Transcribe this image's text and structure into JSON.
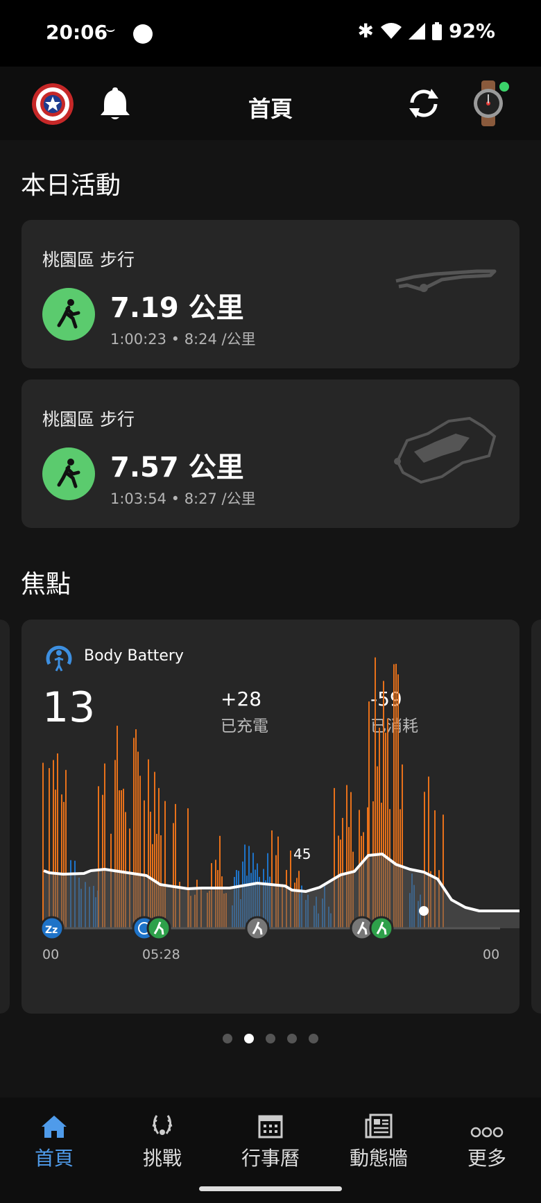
{
  "status_bar": {
    "time": "20:06",
    "battery": "92%"
  },
  "app_bar": {
    "title": "首頁"
  },
  "today": {
    "heading": "本日活動",
    "activities": [
      {
        "title": "桃園區 步行",
        "distance": "7.19 公里",
        "sub": "1:00:23 • 8:24 /公里",
        "icon": "walking-icon"
      },
      {
        "title": "桃園區 步行",
        "distance": "7.57 公里",
        "sub": "1:03:54 • 8:27 /公里",
        "icon": "walking-icon"
      }
    ]
  },
  "focus": {
    "heading": "焦點",
    "body_battery": {
      "title": "Body Battery",
      "value": "13",
      "charged_value": "+28",
      "charged_label": "已充電",
      "drained_value": "-59",
      "drained_label": "已消耗",
      "peak_label": "45",
      "time_labels": [
        "00",
        "05:28",
        "00"
      ]
    },
    "pager": {
      "count": 5,
      "active_index": 1
    }
  },
  "colors": {
    "accent": "#4f9bea",
    "walk_green": "#5bcb6e",
    "stress_orange": "#e8711a",
    "rest_blue": "#1e73c8",
    "card_bg": "#262626"
  },
  "bottom_nav": {
    "items": [
      {
        "label": "首頁",
        "icon": "home-icon",
        "active": true
      },
      {
        "label": "挑戰",
        "icon": "laurel-icon",
        "active": false
      },
      {
        "label": "行事曆",
        "icon": "calendar-icon",
        "active": false
      },
      {
        "label": "動態牆",
        "icon": "newsfeed-icon",
        "active": false
      },
      {
        "label": "更多",
        "icon": "more-icon",
        "active": false
      }
    ]
  }
}
